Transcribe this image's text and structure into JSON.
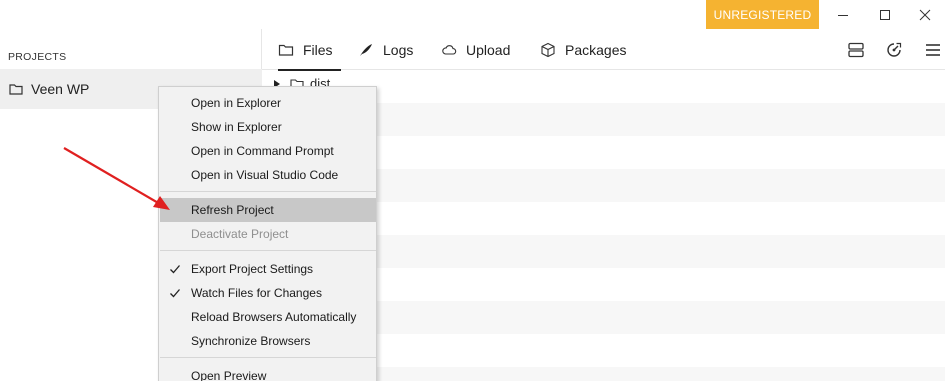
{
  "titlebar": {
    "unregistered_label": "UNREGISTERED",
    "accent_color": "#f5b331"
  },
  "sidebar": {
    "section_label": "PROJECTS",
    "project": {
      "name": "Veen WP",
      "icon": "folder-icon",
      "status_color": "#3aa776"
    }
  },
  "tabs": [
    {
      "label": "Files",
      "icon": "folder-icon"
    },
    {
      "label": "Logs",
      "icon": "feather-icon"
    },
    {
      "label": "Upload",
      "icon": "cloud-icon"
    },
    {
      "label": "Packages",
      "icon": "package-icon"
    }
  ],
  "files": [
    {
      "name": "dist",
      "icon": "folder-icon"
    }
  ],
  "context_menu": {
    "items": [
      {
        "label": "Open in Explorer"
      },
      {
        "label": "Show in Explorer"
      },
      {
        "label": "Open in Command Prompt"
      },
      {
        "label": "Open in Visual Studio Code"
      },
      {
        "label": "Refresh Project",
        "highlighted": true
      },
      {
        "label": "Deactivate Project",
        "disabled": true
      },
      {
        "label": "Export Project Settings",
        "checked": true
      },
      {
        "label": "Watch Files for Changes",
        "checked": true
      },
      {
        "label": "Reload Browsers Automatically"
      },
      {
        "label": "Synchronize Browsers"
      },
      {
        "label": "Open Preview"
      }
    ]
  },
  "annotation": {
    "arrow_color": "#e02020"
  }
}
